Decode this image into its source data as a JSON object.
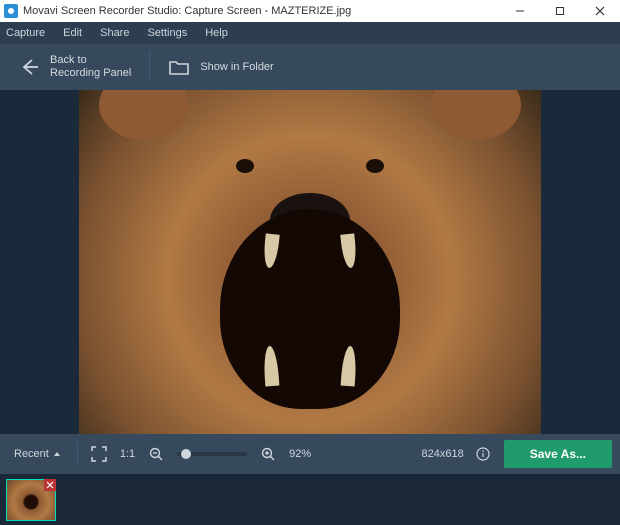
{
  "window": {
    "title": "Movavi Screen Recorder Studio: Capture Screen - MAZTERIZE.jpg"
  },
  "menu": {
    "items": [
      "Capture",
      "Edit",
      "Share",
      "Settings",
      "Help"
    ]
  },
  "actionbar": {
    "back": {
      "line1": "Back to",
      "line2": "Recording Panel"
    },
    "show_in_folder": "Show in Folder"
  },
  "controls": {
    "recent": "Recent",
    "ratio_label": "1:1",
    "zoom_pct": "92%",
    "dimensions": "824x618",
    "save_as": "Save As..."
  },
  "thumbnails": {
    "count": 1
  }
}
